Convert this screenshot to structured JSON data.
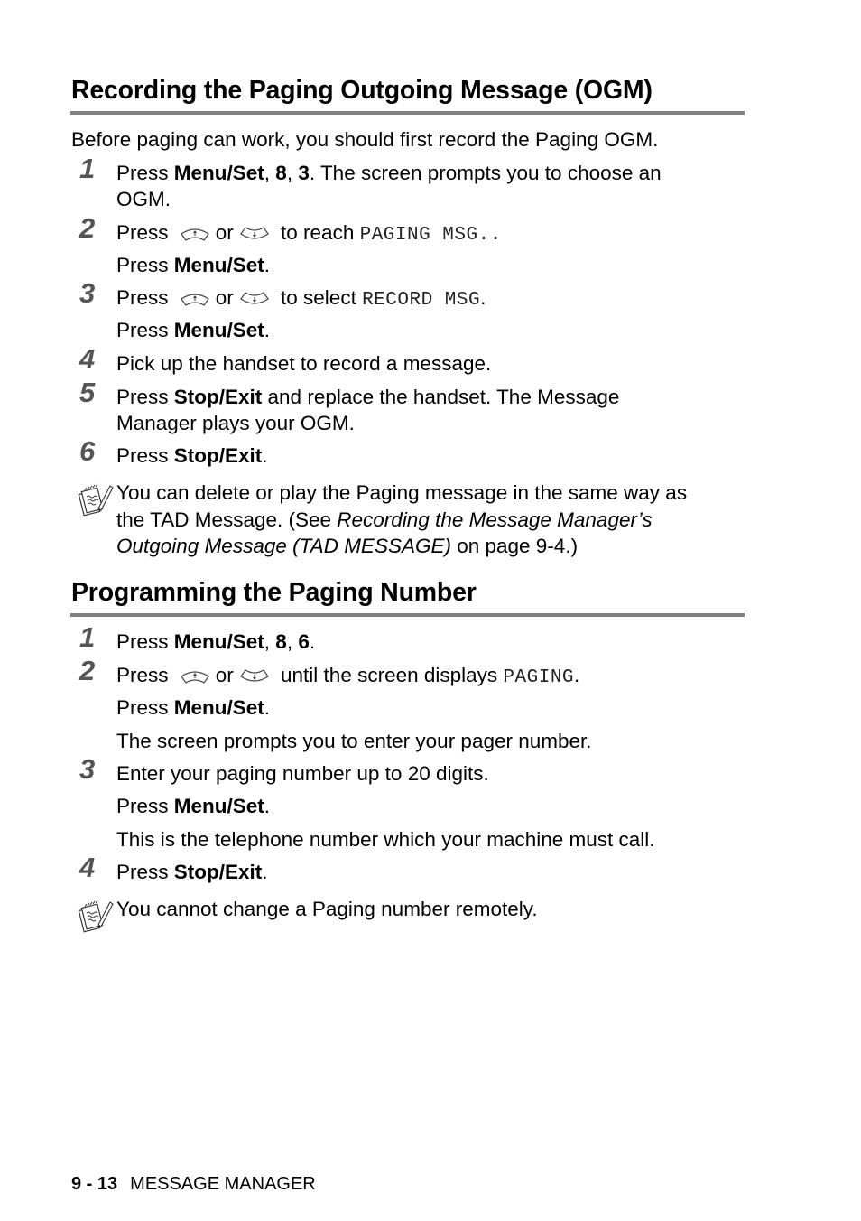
{
  "section1": {
    "title": "Recording the Paging Outgoing Message (OGM)",
    "intro": "Before paging can work, you should first record the Paging OGM.",
    "steps": [
      {
        "num": "1",
        "pre": "Press ",
        "b1": "Menu/Set",
        "sep1": ", ",
        "b2": "8",
        "sep2": ", ",
        "b3": "3",
        "post": ". The screen prompts you to choose an",
        "line2": "OGM."
      },
      {
        "num": "2",
        "pre": "Press ",
        "or": "or",
        "mid": " to reach ",
        "lcd": "PAGING MSG.",
        "post": ".",
        "sub_pre": "Press ",
        "sub_b": "Menu/Set",
        "sub_post": "."
      },
      {
        "num": "3",
        "pre": "Press ",
        "or": "or",
        "mid": " to select ",
        "lcd": "RECORD MSG",
        "post": ".",
        "sub_pre": "Press ",
        "sub_b": "Menu/Set",
        "sub_post": "."
      },
      {
        "num": "4",
        "text": "Pick up the handset to record a message."
      },
      {
        "num": "5",
        "pre": "Press ",
        "b": "Stop/Exit",
        "post": " and replace the handset. The Message",
        "line2": "Manager plays your OGM."
      },
      {
        "num": "6",
        "pre": "Press ",
        "b": "Stop/Exit",
        "post": "."
      }
    ],
    "note": {
      "line1": "You can delete or play the Paging message in the same way as",
      "line2_pre": "the TAD Message. (See ",
      "line2_i": "Recording the Message Manager’s",
      "line3_i": "Outgoing Message (TAD MESSAGE)",
      "line3_post": " on page 9-4.)"
    }
  },
  "section2": {
    "title": "Programming the Paging Number",
    "steps": [
      {
        "num": "1",
        "pre": "Press ",
        "b1": "Menu/Set",
        "sep1": ", ",
        "b2": "8",
        "sep2": ", ",
        "b3": "6",
        "post": "."
      },
      {
        "num": "2",
        "pre": "Press ",
        "or": "or",
        "mid": " until the screen displays ",
        "lcd": "PAGING",
        "post": ".",
        "sub_pre": "Press ",
        "sub_b": "Menu/Set",
        "sub_post": ".",
        "sub2": "The screen prompts you to enter your pager number."
      },
      {
        "num": "3",
        "text": "Enter your paging number up to 20 digits.",
        "sub_pre": "Press ",
        "sub_b": "Menu/Set",
        "sub_post": ".",
        "sub2": "This is the telephone number which your machine must call."
      },
      {
        "num": "4",
        "pre": "Press ",
        "b": "Stop/Exit",
        "post": "."
      }
    ],
    "note": {
      "text": "You cannot change a Paging number remotely."
    }
  },
  "footer": {
    "page": "9 - 13",
    "chapter": "MESSAGE MANAGER"
  }
}
